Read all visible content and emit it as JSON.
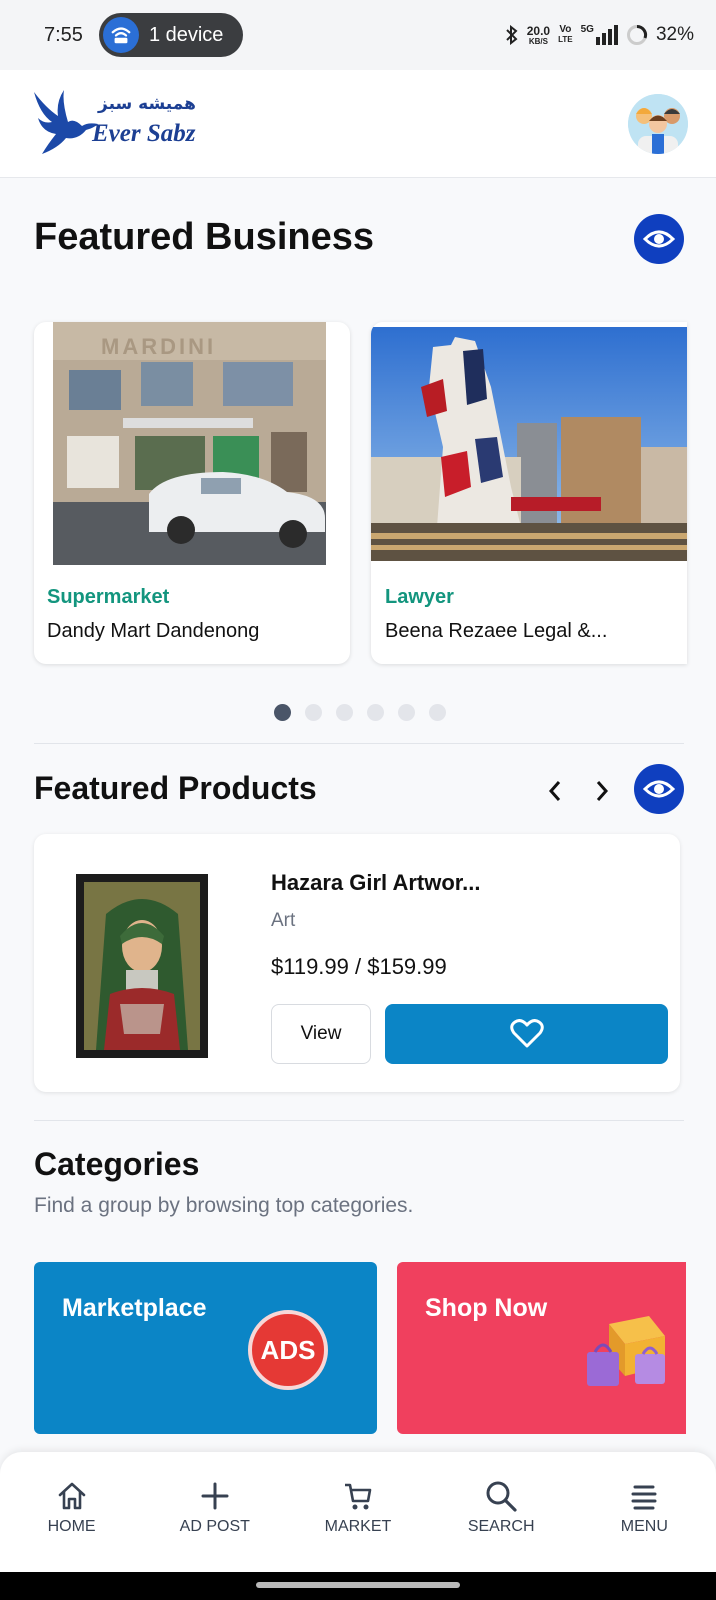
{
  "status_bar": {
    "time": "7:55",
    "hotspot_label": "1 device",
    "net_speed_value": "20.0",
    "net_speed_unit": "KB/S",
    "volte_top": "Vo",
    "volte_bottom": "LTE",
    "network": "5G",
    "battery": "32%"
  },
  "header": {
    "logo_urdu": "همیشه سبز",
    "logo_english": "Ever Sabz"
  },
  "featured_business": {
    "title": "Featured Business",
    "cards": [
      {
        "category": "Supermarket",
        "name": "Dandy Mart Dandenong",
        "storefront_sign": "MARDINI"
      },
      {
        "category": "Lawyer",
        "name": "Beena Rezaee Legal &..."
      }
    ],
    "pagination": {
      "total": 6,
      "active_index": 0
    }
  },
  "featured_products": {
    "title": "Featured Products",
    "product": {
      "title": "Hazara Girl Artwor...",
      "category": "Art",
      "price": "$119.99 / $159.99",
      "view_label": "View"
    }
  },
  "categories": {
    "title": "Categories",
    "subtitle": "Find a group by browsing top categories.",
    "items": [
      {
        "label": "Marketplace",
        "badge": "ADS",
        "color": "#0b85c6"
      },
      {
        "label": "Shop Now",
        "color": "#f0405e"
      }
    ]
  },
  "bottom_nav": {
    "items": [
      {
        "label": "HOME",
        "icon": "home-icon"
      },
      {
        "label": "AD POST",
        "icon": "plus-icon"
      },
      {
        "label": "MARKET",
        "icon": "cart-icon"
      },
      {
        "label": "SEARCH",
        "icon": "search-icon"
      },
      {
        "label": "MENU",
        "icon": "menu-icon"
      }
    ]
  },
  "colors": {
    "primary": "#0f3fbf",
    "accent_blue": "#0b85c6",
    "teal": "#13957e",
    "pink": "#f0405e"
  }
}
